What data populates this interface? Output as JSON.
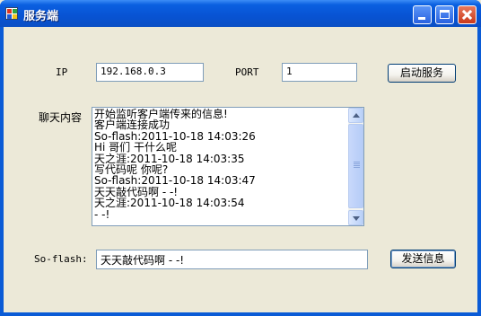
{
  "window": {
    "title": "服务端"
  },
  "form": {
    "ip_label": "IP",
    "ip_value": "192.168.0.3",
    "port_label": "PORT",
    "port_value": "1",
    "start_button": "启动服务",
    "chat_label": "聊天内容",
    "chat_lines": [
      "开始监听客户端传来的信息!",
      "客户端连接成功",
      "So-flash:2011-10-18 14:03:26",
      "Hi 哥们 干什么呢",
      "天之涯:2011-10-18 14:03:35",
      "写代码呢  你呢?",
      "So-flash:2011-10-18 14:03:47",
      "天天敲代码啊 - -!",
      "天之涯:2011-10-18 14:03:54",
      "- -!"
    ],
    "sender_label": "So-flash:",
    "message_value": "天天敲代码啊 - -!",
    "send_button": "发送信息"
  }
}
